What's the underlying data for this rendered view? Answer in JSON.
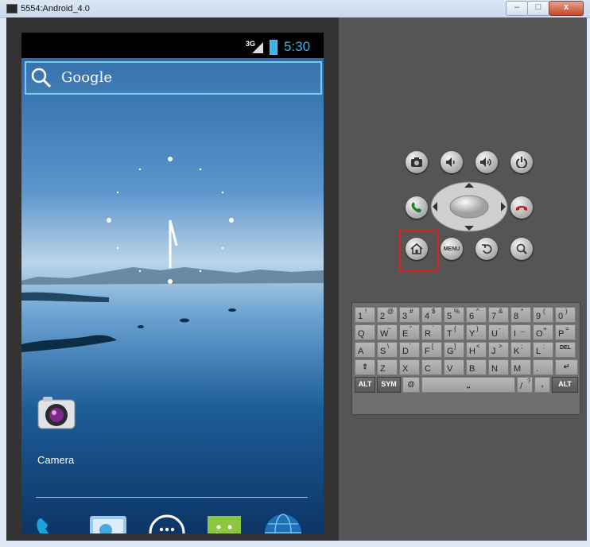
{
  "window": {
    "title": "5554:Android_4.0",
    "minimize_glyph": "–",
    "maximize_glyph": "□",
    "close_glyph": "x"
  },
  "device": {
    "status": {
      "network": "3G",
      "time": "5:30"
    },
    "search": {
      "placeholder": "Google"
    },
    "desktop_icon": {
      "name": "camera-icon",
      "label": "Camera"
    },
    "dock": [
      {
        "icon": "phone-icon"
      },
      {
        "icon": "contacts-icon"
      },
      {
        "icon": "all-apps-icon"
      },
      {
        "icon": "messaging-icon"
      },
      {
        "icon": "browser-icon"
      }
    ],
    "colors": {
      "accent": "#33b5e5",
      "sky_top": "#2b6aa9",
      "water": "#1d5c97"
    }
  },
  "controls": {
    "row1": [
      "camera-icon",
      "volume-down-icon",
      "volume-up-icon",
      "power-icon"
    ],
    "call": "call-icon",
    "end_call": "end-call-icon",
    "dpad": "dpad-icon",
    "row3": [
      "home-icon",
      "menu-icon",
      "back-icon",
      "search-icon"
    ],
    "menu_label": "MENU",
    "highlight_color": "#e02020",
    "highlighted_button": "home-icon"
  },
  "keyboard": {
    "rows": [
      [
        [
          "1",
          "!"
        ],
        [
          "2",
          "@"
        ],
        [
          "3",
          "#"
        ],
        [
          "4",
          "$"
        ],
        [
          "5",
          "%"
        ],
        [
          "6",
          "^"
        ],
        [
          "7",
          "&"
        ],
        [
          "8",
          "*"
        ],
        [
          "9",
          "("
        ],
        [
          "0",
          ")"
        ]
      ],
      [
        [
          "Q",
          ""
        ],
        [
          "W",
          "~"
        ],
        [
          "E",
          "\""
        ],
        [
          "R",
          "`"
        ],
        [
          "T",
          "{"
        ],
        [
          "Y",
          "}"
        ],
        [
          "U",
          "-"
        ],
        [
          "I",
          "_"
        ],
        [
          "O",
          "+"
        ],
        [
          "P",
          "="
        ]
      ],
      [
        [
          "A",
          ""
        ],
        [
          "S",
          "\\"
        ],
        [
          "D",
          "'"
        ],
        [
          "F",
          "["
        ],
        [
          "G",
          "]"
        ],
        [
          "H",
          "<"
        ],
        [
          "J",
          ">"
        ],
        [
          "K",
          ";"
        ],
        [
          "L",
          ":"
        ]
      ],
      [
        [
          "Z",
          ""
        ],
        [
          "X",
          ""
        ],
        [
          "C",
          ""
        ],
        [
          "V",
          ""
        ],
        [
          "B",
          ""
        ],
        [
          "N",
          ""
        ],
        [
          "M",
          ""
        ],
        [
          ".",
          ""
        ]
      ]
    ],
    "del_label": "DEL",
    "shift_symbol": "⇧",
    "enter_symbol": "↵",
    "alt_label": "ALT",
    "sym_label": "SYM",
    "at_label": "@",
    "tab_symbol": "⇥",
    "slash_label": "/",
    "question_label": "?",
    "comma_label": ",",
    "space_symbol": "⎵"
  }
}
